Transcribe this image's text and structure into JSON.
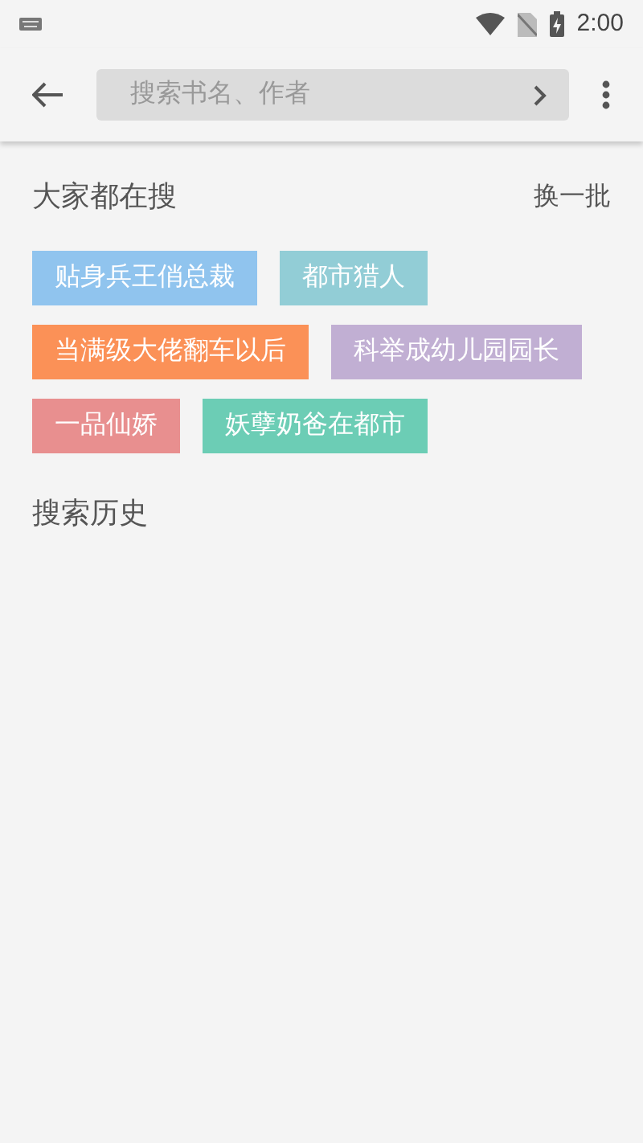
{
  "status_bar": {
    "time": "2:00"
  },
  "search": {
    "placeholder": "搜索书名、作者"
  },
  "hot_searches": {
    "title": "大家都在搜",
    "refresh": "换一批",
    "tags": [
      {
        "label": "贴身兵王俏总裁",
        "color": "#90c4ee"
      },
      {
        "label": "都市猎人",
        "color": "#92cdd6"
      },
      {
        "label": "当满级大佬翻车以后",
        "color": "#fb9157"
      },
      {
        "label": "科举成幼儿园园长",
        "color": "#c1afd3"
      },
      {
        "label": "一品仙娇",
        "color": "#e88f8f"
      },
      {
        "label": "妖孽奶爸在都市",
        "color": "#6ccdb5"
      }
    ]
  },
  "history": {
    "title": "搜索历史"
  }
}
